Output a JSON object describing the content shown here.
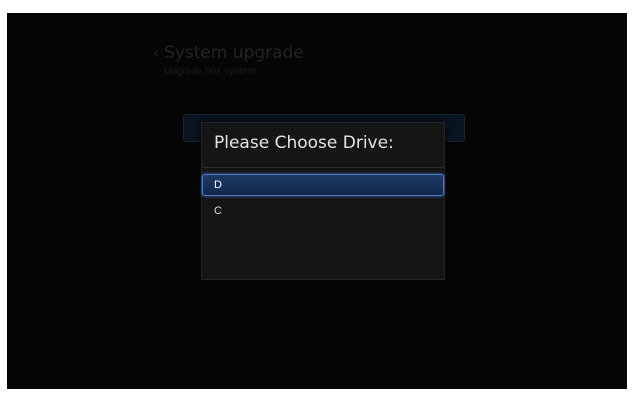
{
  "page": {
    "title": "System upgrade",
    "subtitle": "Upgrade box system",
    "back_icon": "chevron-left-icon"
  },
  "dialog": {
    "title": "Please Choose Drive:",
    "items": [
      {
        "label": "D",
        "selected": true
      },
      {
        "label": "C",
        "selected": false
      }
    ]
  },
  "colors": {
    "background": "#050505",
    "dialog": "#151515",
    "selection": "#1d3a66",
    "selection_border": "#4d7cc2",
    "text": "#e4e4e4"
  }
}
